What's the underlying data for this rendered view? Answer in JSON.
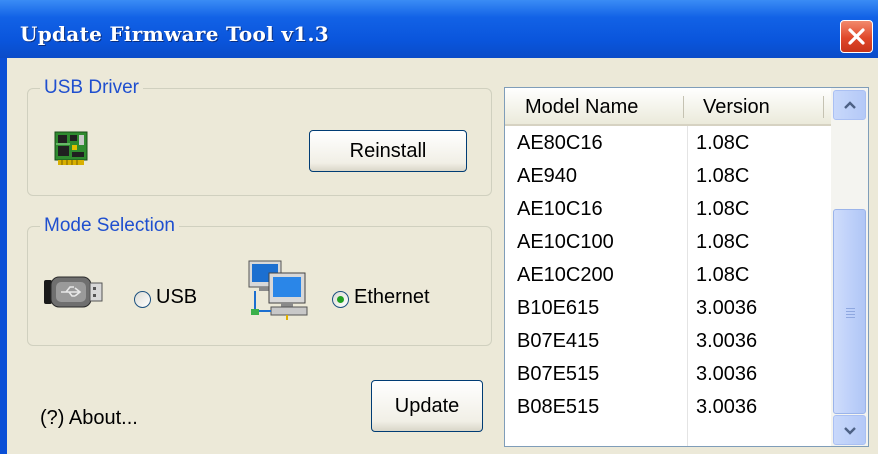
{
  "window": {
    "title": "Update Firmware Tool v1.3",
    "title_color": "#0a55dc"
  },
  "usb_driver": {
    "group_label": "USB Driver",
    "reinstall_label": "Reinstall"
  },
  "mode_selection": {
    "group_label": "Mode Selection",
    "options": [
      {
        "label": "USB",
        "selected": false
      },
      {
        "label": "Ethernet",
        "selected": true
      }
    ]
  },
  "about_label": "(?) About...",
  "update_label": "Update",
  "table": {
    "columns": [
      "Model Name",
      "Version"
    ],
    "rows": [
      {
        "model": "AE80C16",
        "version": "1.08C"
      },
      {
        "model": "AE940",
        "version": "1.08C"
      },
      {
        "model": "AE10C16",
        "version": "1.08C"
      },
      {
        "model": "AE10C100",
        "version": "1.08C"
      },
      {
        "model": "AE10C200",
        "version": "1.08C"
      },
      {
        "model": "B10E615",
        "version": "3.0036"
      },
      {
        "model": "B07E415",
        "version": "3.0036"
      },
      {
        "model": "B07E515",
        "version": "3.0036"
      },
      {
        "model": "B08E515",
        "version": "3.0036"
      }
    ]
  },
  "icons": [
    "close-icon",
    "circuit-board-icon",
    "usb-drive-icon",
    "computer-network-icon",
    "scroll-up-arrow-icon",
    "scroll-down-arrow-icon"
  ],
  "colors": {
    "accent": "#1f4fcf",
    "selected_radio": "#21a121",
    "close": "#e0482a"
  }
}
